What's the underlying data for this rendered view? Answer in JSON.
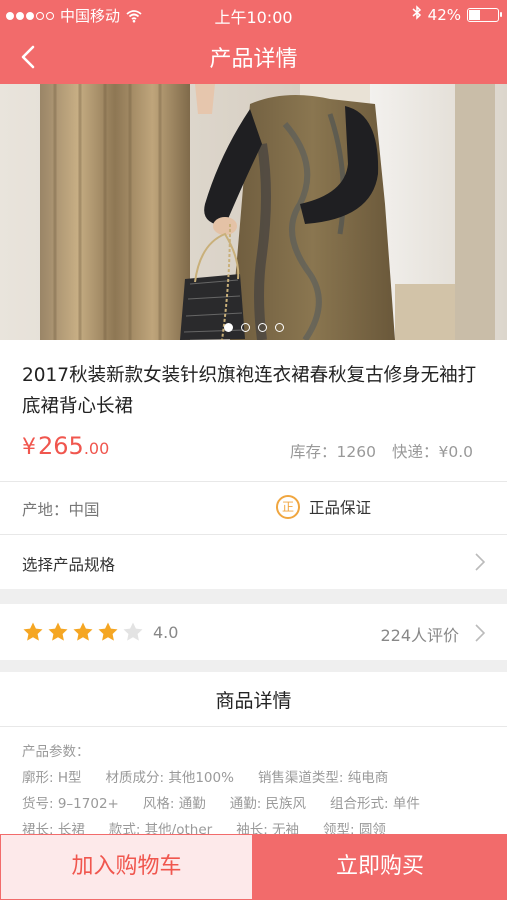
{
  "status_bar": {
    "carrier": "中国移动",
    "time": "上午10:00",
    "battery_text": "42%",
    "battery_level": 0.42,
    "signal_bars": 3,
    "signal_total": 5,
    "icons": [
      "wifi-icon",
      "bluetooth-icon",
      "battery-icon"
    ]
  },
  "nav": {
    "title": "产品详情",
    "back_icon": "chevron-left-icon"
  },
  "carousel": {
    "image_desc_icon": "product-photo",
    "pages": 4,
    "active_page": 1
  },
  "product": {
    "title": "2017秋装新款女装针织旗袍连衣裙春秋复古修身无袖打底裙背心长裙",
    "price_symbol": "¥",
    "price_main": "265",
    "price_cents": ".00",
    "stock": "库存：1260",
    "shipping": "快递：¥0.0",
    "origin": "产地：中国",
    "guarantee_badge": "正",
    "guarantee": "正品保证",
    "spec_label": "选择产品规格"
  },
  "rating": {
    "stars_filled": 4,
    "stars_total": 5,
    "score": "4.0",
    "reviews": "224人评价"
  },
  "detail": {
    "heading": "商品详情",
    "params_title": "产品参数：",
    "lines": [
      [
        "廓形: H型",
        "材质成分: 其他100%",
        "销售渠道类型: 纯电商"
      ],
      [
        "货号: 9–1702+",
        "风格: 通勤",
        "通勤: 民族风",
        "组合形式: 单件"
      ],
      [
        "裙长: 长裙",
        "款式: 其他/other",
        "袖长: 无袖",
        "领型: 圆领"
      ]
    ]
  },
  "actions": {
    "add_to_cart": "加入购物车",
    "buy_now": "立即购买"
  },
  "colors": {
    "brand": "#f26b6b",
    "price": "#f0564e",
    "star": "#f5a623",
    "guarantee": "#f0a640"
  }
}
